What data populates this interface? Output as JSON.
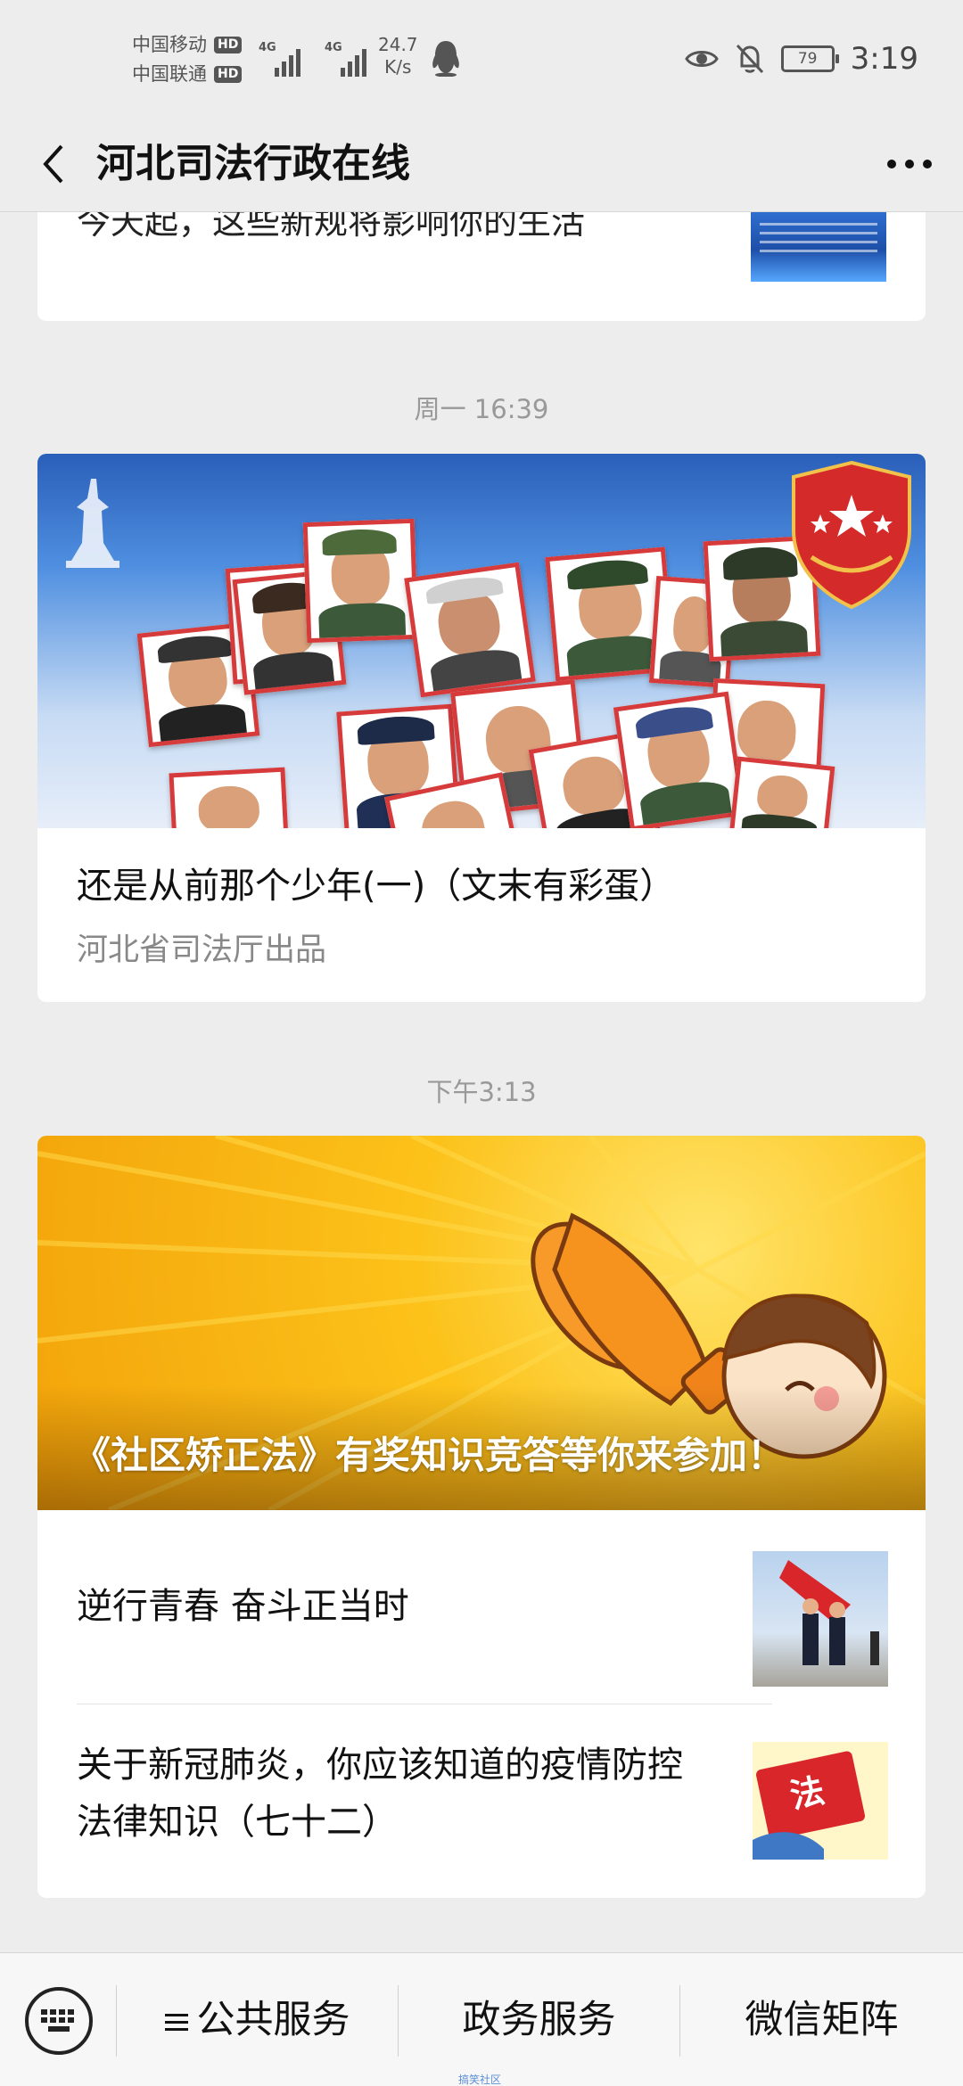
{
  "status_bar": {
    "carrier_1": "中国移动",
    "carrier_2": "中国联通",
    "hd_label": "HD",
    "network_type": "4G",
    "net_speed_value": "24.7",
    "net_speed_unit": "K/s",
    "battery_level": "79",
    "time": "3:19",
    "icons": [
      "qq-icon",
      "eye-icon",
      "mute-bell-icon",
      "battery-icon"
    ]
  },
  "nav": {
    "title": "河北司法行政在线",
    "back_icon": "chevron-left-icon",
    "more_icon": "more-dots-icon"
  },
  "feed": {
    "partial_article": {
      "title": "今天起，这些新规将影响你的生活"
    },
    "groups": [
      {
        "time": "周一 16:39",
        "cover_article": {
          "title": "还是从前那个少年(一)（文末有彩蛋）",
          "subtitle": "河北省司法厅出品"
        }
      },
      {
        "time": "下午3:13",
        "cover_article": {
          "title": "《社区矫正法》有奖知识竞答等你来参加！"
        },
        "articles": [
          {
            "title_line_1": "逆行青春 奋斗正当时"
          },
          {
            "title_line_1": "关于新冠肺炎，你应该知道的疫情防控",
            "title_line_2": "法律知识（七十二）",
            "thumb_text": "法"
          }
        ]
      }
    ]
  },
  "bottom_menu": {
    "keyboard_icon": "keyboard-icon",
    "items": [
      {
        "label": "公共服务",
        "icon": "menu-list-icon"
      },
      {
        "label": "政务服务"
      },
      {
        "label": "微信矩阵"
      }
    ]
  },
  "watermark": "搞笑社区",
  "colors": {
    "background": "#ededed",
    "card": "#ffffff",
    "time_label": "#999999",
    "subtitle": "#888888",
    "accent_red": "#d63a3a"
  }
}
